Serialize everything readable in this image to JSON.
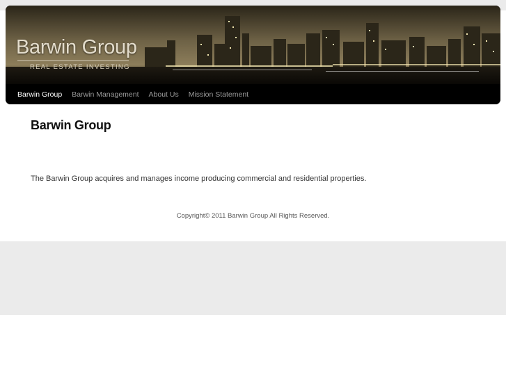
{
  "header": {
    "logo_title": "Barwin Group",
    "logo_subtitle": "REAL ESTATE INVESTING"
  },
  "nav": {
    "items": [
      {
        "label": "Barwin Group",
        "active": true
      },
      {
        "label": "Barwin Management",
        "active": false
      },
      {
        "label": "About Us",
        "active": false
      },
      {
        "label": "Mission Statement",
        "active": false
      }
    ]
  },
  "main": {
    "title": "Barwin Group",
    "intro": "The Barwin Group acquires and manages income producing commercial and residential properties."
  },
  "footer": {
    "copyright": "Copyright© 2011 Barwin Group All Rights Reserved."
  },
  "colors": {
    "nav_background": "#000000",
    "nav_text": "#9a9a9a",
    "nav_active_text": "#ffffff",
    "band_background": "#ebebeb"
  }
}
